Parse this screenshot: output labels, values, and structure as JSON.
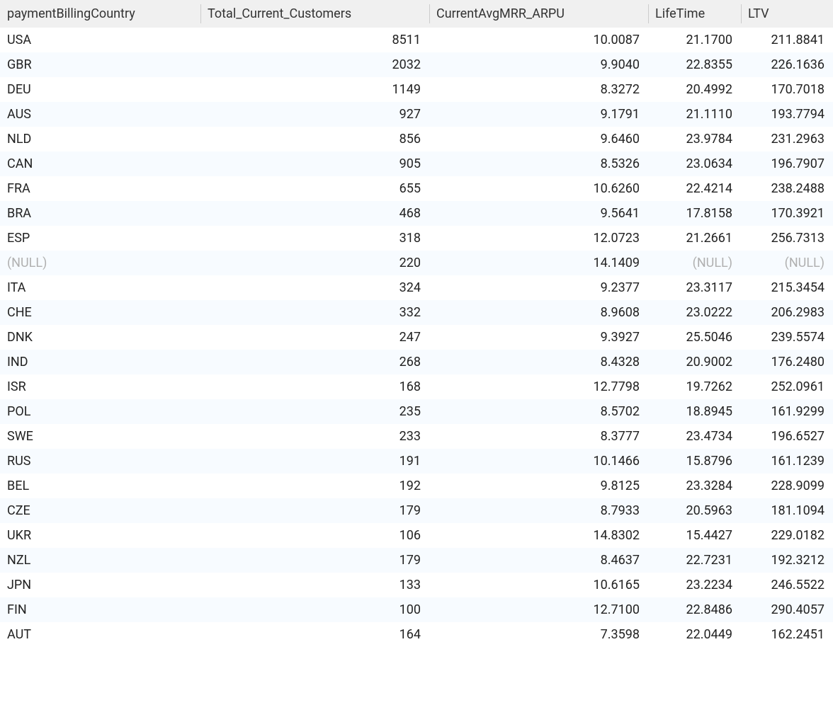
{
  "nullLabel": "(NULL)",
  "columns": [
    {
      "key": "paymentBillingCountry",
      "label": "paymentBillingCountry",
      "align": "left",
      "class": "col-country"
    },
    {
      "key": "Total_Current_Customers",
      "label": "Total_Current_Customers",
      "align": "right",
      "class": "col-customers"
    },
    {
      "key": "CurrentAvgMRR_ARPU",
      "label": "CurrentAvgMRR_ARPU",
      "align": "right",
      "class": "col-arpu"
    },
    {
      "key": "LifeTime",
      "label": "LifeTime",
      "align": "right",
      "class": "col-lifetime"
    },
    {
      "key": "LTV",
      "label": "LTV",
      "align": "right",
      "class": "col-ltv"
    }
  ],
  "rows": [
    {
      "paymentBillingCountry": "USA",
      "Total_Current_Customers": "8511",
      "CurrentAvgMRR_ARPU": "10.0087",
      "LifeTime": "21.1700",
      "LTV": "211.8841"
    },
    {
      "paymentBillingCountry": "GBR",
      "Total_Current_Customers": "2032",
      "CurrentAvgMRR_ARPU": "9.9040",
      "LifeTime": "22.8355",
      "LTV": "226.1636"
    },
    {
      "paymentBillingCountry": "DEU",
      "Total_Current_Customers": "1149",
      "CurrentAvgMRR_ARPU": "8.3272",
      "LifeTime": "20.4992",
      "LTV": "170.7018"
    },
    {
      "paymentBillingCountry": "AUS",
      "Total_Current_Customers": "927",
      "CurrentAvgMRR_ARPU": "9.1791",
      "LifeTime": "21.1110",
      "LTV": "193.7794"
    },
    {
      "paymentBillingCountry": "NLD",
      "Total_Current_Customers": "856",
      "CurrentAvgMRR_ARPU": "9.6460",
      "LifeTime": "23.9784",
      "LTV": "231.2963"
    },
    {
      "paymentBillingCountry": "CAN",
      "Total_Current_Customers": "905",
      "CurrentAvgMRR_ARPU": "8.5326",
      "LifeTime": "23.0634",
      "LTV": "196.7907"
    },
    {
      "paymentBillingCountry": "FRA",
      "Total_Current_Customers": "655",
      "CurrentAvgMRR_ARPU": "10.6260",
      "LifeTime": "22.4214",
      "LTV": "238.2488"
    },
    {
      "paymentBillingCountry": "BRA",
      "Total_Current_Customers": "468",
      "CurrentAvgMRR_ARPU": "9.5641",
      "LifeTime": "17.8158",
      "LTV": "170.3921"
    },
    {
      "paymentBillingCountry": "ESP",
      "Total_Current_Customers": "318",
      "CurrentAvgMRR_ARPU": "12.0723",
      "LifeTime": "21.2661",
      "LTV": "256.7313"
    },
    {
      "paymentBillingCountry": null,
      "Total_Current_Customers": "220",
      "CurrentAvgMRR_ARPU": "14.1409",
      "LifeTime": null,
      "LTV": null
    },
    {
      "paymentBillingCountry": "ITA",
      "Total_Current_Customers": "324",
      "CurrentAvgMRR_ARPU": "9.2377",
      "LifeTime": "23.3117",
      "LTV": "215.3454"
    },
    {
      "paymentBillingCountry": "CHE",
      "Total_Current_Customers": "332",
      "CurrentAvgMRR_ARPU": "8.9608",
      "LifeTime": "23.0222",
      "LTV": "206.2983"
    },
    {
      "paymentBillingCountry": "DNK",
      "Total_Current_Customers": "247",
      "CurrentAvgMRR_ARPU": "9.3927",
      "LifeTime": "25.5046",
      "LTV": "239.5574"
    },
    {
      "paymentBillingCountry": "IND",
      "Total_Current_Customers": "268",
      "CurrentAvgMRR_ARPU": "8.4328",
      "LifeTime": "20.9002",
      "LTV": "176.2480"
    },
    {
      "paymentBillingCountry": "ISR",
      "Total_Current_Customers": "168",
      "CurrentAvgMRR_ARPU": "12.7798",
      "LifeTime": "19.7262",
      "LTV": "252.0961"
    },
    {
      "paymentBillingCountry": "POL",
      "Total_Current_Customers": "235",
      "CurrentAvgMRR_ARPU": "8.5702",
      "LifeTime": "18.8945",
      "LTV": "161.9299"
    },
    {
      "paymentBillingCountry": "SWE",
      "Total_Current_Customers": "233",
      "CurrentAvgMRR_ARPU": "8.3777",
      "LifeTime": "23.4734",
      "LTV": "196.6527"
    },
    {
      "paymentBillingCountry": "RUS",
      "Total_Current_Customers": "191",
      "CurrentAvgMRR_ARPU": "10.1466",
      "LifeTime": "15.8796",
      "LTV": "161.1239"
    },
    {
      "paymentBillingCountry": "BEL",
      "Total_Current_Customers": "192",
      "CurrentAvgMRR_ARPU": "9.8125",
      "LifeTime": "23.3284",
      "LTV": "228.9099"
    },
    {
      "paymentBillingCountry": "CZE",
      "Total_Current_Customers": "179",
      "CurrentAvgMRR_ARPU": "8.7933",
      "LifeTime": "20.5963",
      "LTV": "181.1094"
    },
    {
      "paymentBillingCountry": "UKR",
      "Total_Current_Customers": "106",
      "CurrentAvgMRR_ARPU": "14.8302",
      "LifeTime": "15.4427",
      "LTV": "229.0182"
    },
    {
      "paymentBillingCountry": "NZL",
      "Total_Current_Customers": "179",
      "CurrentAvgMRR_ARPU": "8.4637",
      "LifeTime": "22.7231",
      "LTV": "192.3212"
    },
    {
      "paymentBillingCountry": "JPN",
      "Total_Current_Customers": "133",
      "CurrentAvgMRR_ARPU": "10.6165",
      "LifeTime": "23.2234",
      "LTV": "246.5522"
    },
    {
      "paymentBillingCountry": "FIN",
      "Total_Current_Customers": "100",
      "CurrentAvgMRR_ARPU": "12.7100",
      "LifeTime": "22.8486",
      "LTV": "290.4057"
    },
    {
      "paymentBillingCountry": "AUT",
      "Total_Current_Customers": "164",
      "CurrentAvgMRR_ARPU": "7.3598",
      "LifeTime": "22.0449",
      "LTV": "162.2451"
    }
  ]
}
